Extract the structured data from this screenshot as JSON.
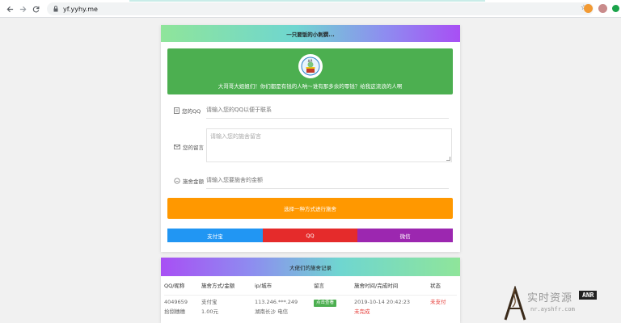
{
  "browser": {
    "url": "yf.yyhy.me",
    "back_icon": "arrow-left-icon",
    "forward_icon": "arrow-right-icon",
    "reload_icon": "reload-icon"
  },
  "donate": {
    "header_title": "一只要饭的小刺猬...",
    "hero_text": "大哥哥大姐姐们！你们都是有钱的人呐～谁有那多余的零钱？给我这流浪的人啊",
    "qq_label": "您的QQ",
    "qq_placeholder": "请输入您的QQ以便于联系",
    "msg_label": "您的留言",
    "msg_placeholder": "请输入您的施舍留言",
    "amount_label": "施舍金额",
    "amount_placeholder": "请输入您要施舍的金额",
    "choose_label": "选择一种方式进行施舍",
    "methods": [
      {
        "label": "支付宝",
        "color": "#2196f3"
      },
      {
        "label": "QQ",
        "color": "#e52b2b"
      },
      {
        "label": "微信",
        "color": "#9c27b0"
      }
    ]
  },
  "records": {
    "title": "大佬们的施舍记录",
    "headers": [
      "QQ/昵称",
      "施舍方式/金额",
      "ip/城市",
      "留言",
      "施舍时间/完成时间",
      "状态"
    ],
    "rows": [
      {
        "qq": "4049659",
        "nick": "拾捌穗穗",
        "method": "支付宝",
        "amount": "1.00元",
        "ip": "113.246.***.249",
        "city": "湖南长沙 电信",
        "msg_btn": "点击查看",
        "time": "2019-10-14 20:42:23",
        "done": "未完成",
        "status": "未支付"
      }
    ]
  },
  "watermark": {
    "cn": "实时资源",
    "tag": "ANR",
    "url": "nr.ayshfr.com"
  },
  "colors": {
    "hero": "#4caf50",
    "pay_main": "#ff9800",
    "status_red": "#e53935"
  }
}
